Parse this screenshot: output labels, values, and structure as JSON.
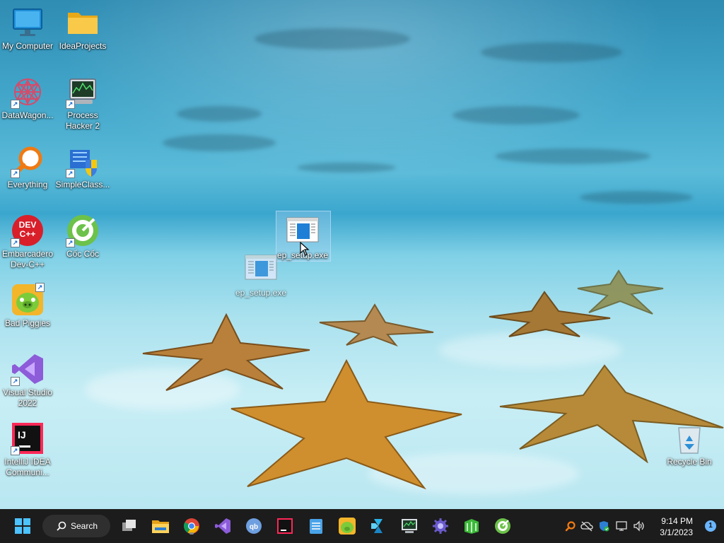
{
  "desktop": {
    "icons": {
      "my_computer": "My Computer",
      "idea_projects": "IdeaProjects",
      "datawagon": "DataWagon...",
      "process_hacker_line1": "Process",
      "process_hacker_line2": "Hacker 2",
      "everything": "Everything",
      "simpleclass": "SimpleClass...",
      "embarcadero_line1": "Embarcadero",
      "embarcadero_line2": "Dev-C++",
      "coc_coc": "Cốc Cốc",
      "bad_piggies": "Bad Piggies",
      "visual_studio_line1": "Visual Studio",
      "visual_studio_line2": "2022",
      "intellij_line1": "IntelliJ IDEA",
      "intellij_line2": "Communi...",
      "ep_setup": "ep_setup.exe",
      "ep_setup_ghost": "ep_setup.exe",
      "recycle_bin": "Recycle Bin"
    },
    "icon_badges": {
      "devcpp_line1": "DEV",
      "devcpp_line2": "C++",
      "intellij": "IJ"
    }
  },
  "taskbar": {
    "search_label": "Search",
    "clock_time": "9:14 PM",
    "clock_date": "3/1/2023",
    "notification_count": "1",
    "apps": [
      "start-icon",
      "task-view-icon",
      "file-explorer-icon",
      "chrome-icon",
      "visual-studio-icon",
      "qbittorrent-icon",
      "intellij-icon",
      "notepad-icon",
      "bad-piggies-icon",
      "remote-app-icon",
      "process-hacker-icon",
      "settings-gear-icon",
      "spreadsheet-icon",
      "coc-coc-icon"
    ],
    "tray_icons": [
      "everything-tray-icon",
      "cloud-off-icon",
      "security-shield-icon",
      "network-icon",
      "volume-icon"
    ],
    "accent": "#0078d4"
  }
}
